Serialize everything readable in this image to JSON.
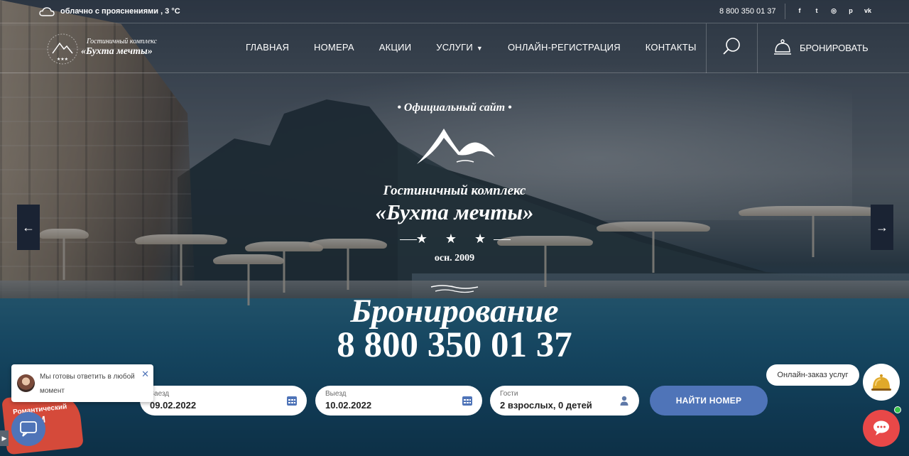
{
  "topbar": {
    "weather": "облачно с прояснениями , 3 °C",
    "phone": "8 800 350 01 37",
    "socials": [
      {
        "icon": "facebook-icon",
        "glyph": "f"
      },
      {
        "icon": "twitter-icon",
        "glyph": "t"
      },
      {
        "icon": "instagram-icon",
        "glyph": "◎"
      },
      {
        "icon": "pinterest-icon",
        "glyph": "p"
      },
      {
        "icon": "vk-icon",
        "glyph": "vk"
      }
    ]
  },
  "header": {
    "logo": {
      "subtitle": "Гостиничный комплекс",
      "name": "«Бухта мечты»"
    },
    "nav": [
      {
        "label": "ГЛАВНАЯ"
      },
      {
        "label": "НОМЕРА"
      },
      {
        "label": "АКЦИИ"
      },
      {
        "label": "УСЛУГИ",
        "has_dropdown": true
      },
      {
        "label": "ОНЛАЙН-РЕГИСТРАЦИЯ"
      },
      {
        "label": "КОНТАКТЫ"
      }
    ],
    "book_label": "БРОНИРОВАТЬ"
  },
  "slider": {
    "prev_glyph": "←",
    "next_glyph": "→"
  },
  "emblem": {
    "official": "• Официальный сайт •",
    "line1": "Гостиничный комплекс",
    "line2": "«Бухта мечты»",
    "stars": "★ ★ ★",
    "established": "осн. 2009"
  },
  "headline": {
    "title": "Бронирование",
    "phone": "8 800 350 01 37"
  },
  "booking": {
    "checkin": {
      "label": "Заезд",
      "value": "09.02.2022"
    },
    "checkout": {
      "label": "Выезд",
      "value": "10.02.2022"
    },
    "guests": {
      "label": "Гости",
      "value": "2 взрослых, 0 детей"
    },
    "submit": "НАЙТИ НОМЕР"
  },
  "chat": {
    "message": "Мы готовы ответить в любой момент",
    "close_glyph": "✕",
    "promo_line1": "Романтический",
    "promo_line2": "IM",
    "order_label": "Онлайн-заказ услуг"
  },
  "colors": {
    "accent": "#4f74b8",
    "chat_red": "#e84848",
    "online": "#3ac24a"
  }
}
